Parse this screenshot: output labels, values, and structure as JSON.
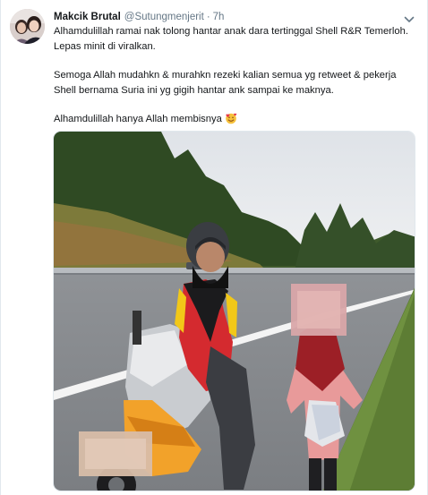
{
  "tweet": {
    "display_name": "Makcik Brutal",
    "handle": "@Sutungmenjerit",
    "separator": "·",
    "time": "7h",
    "lines": [
      "Alhamdulillah ramai nak tolong hantar anak dara tertinggal Shell R&R Temerloh.",
      "Lepas minit di viralkan.",
      "Semoga Allah mudahkn & murahkn rezeki kalian semua yg retweet & pekerja",
      "Shell bernama Suria ini yg gigih hantar ank sampai ke maknya.",
      "Alhamdulillah hanya Allah membisnya"
    ]
  },
  "icons": {
    "caret": "chevron-down-icon",
    "emoji": "smiling-face-with-hearts-icon"
  },
  "colors": {
    "text": "#14171a",
    "secondary": "#657786",
    "border": "#e1e8ed"
  }
}
